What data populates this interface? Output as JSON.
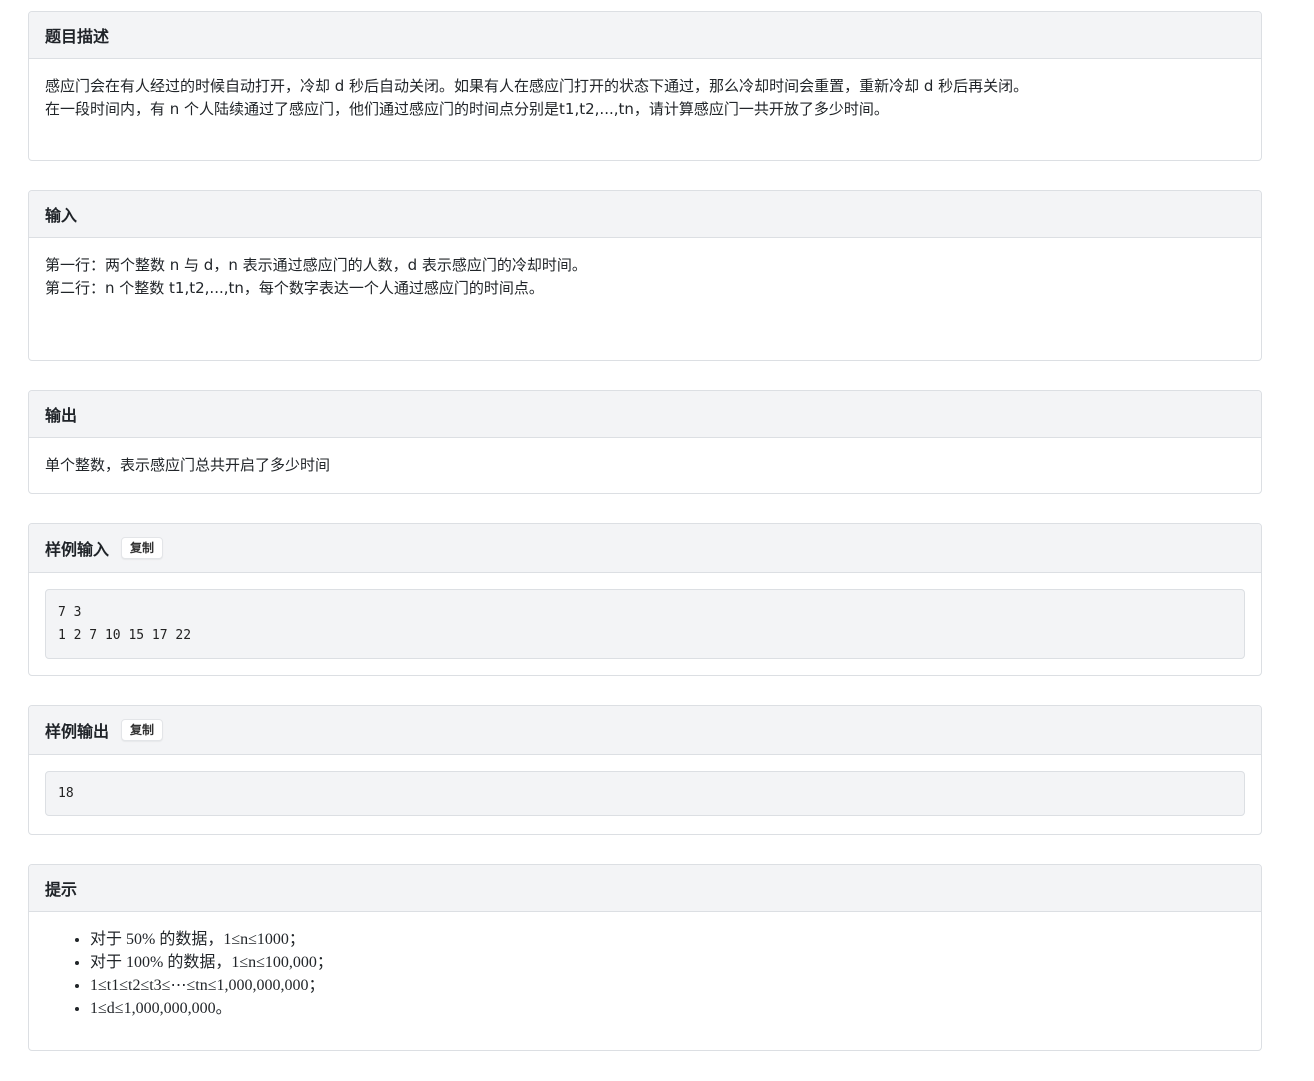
{
  "description": {
    "title": "题目描述",
    "line1": "感应门会在有人经过的时候自动打开，冷却 d 秒后自动关闭。如果有人在感应门打开的状态下通过，那么冷却时间会重置，重新冷却 d 秒后再关闭。",
    "line2": "在一段时间内，有 n 个人陆续通过了感应门，他们通过感应门的时间点分别是t1,t2,...,tn，请计算感应门一共开放了多少时间。"
  },
  "input": {
    "title": "输入",
    "line1": "第一行：两个整数 n 与 d，n 表示通过感应门的人数，d 表示感应门的冷却时间。",
    "line2": "第二行：n 个整数 t1,t2,...,tn，每个数字表达一个人通过感应门的时间点。"
  },
  "output": {
    "title": "输出",
    "line1": "单个整数，表示感应门总共开启了多少时间"
  },
  "sample_input": {
    "title": "样例输入",
    "copy_label": "复制",
    "code": "7 3\n1 2 7 10 15 17 22"
  },
  "sample_output": {
    "title": "样例输出",
    "copy_label": "复制",
    "code": "18"
  },
  "hint": {
    "title": "提示",
    "items": [
      "对于 50% 的数据，1≤n≤1000；",
      "对于 100% 的数据，1≤n≤100,000；",
      "1≤t1≤t2≤t3≤⋯≤tn≤1,000,000,000；",
      "1≤d≤1,000,000,000。"
    ]
  }
}
